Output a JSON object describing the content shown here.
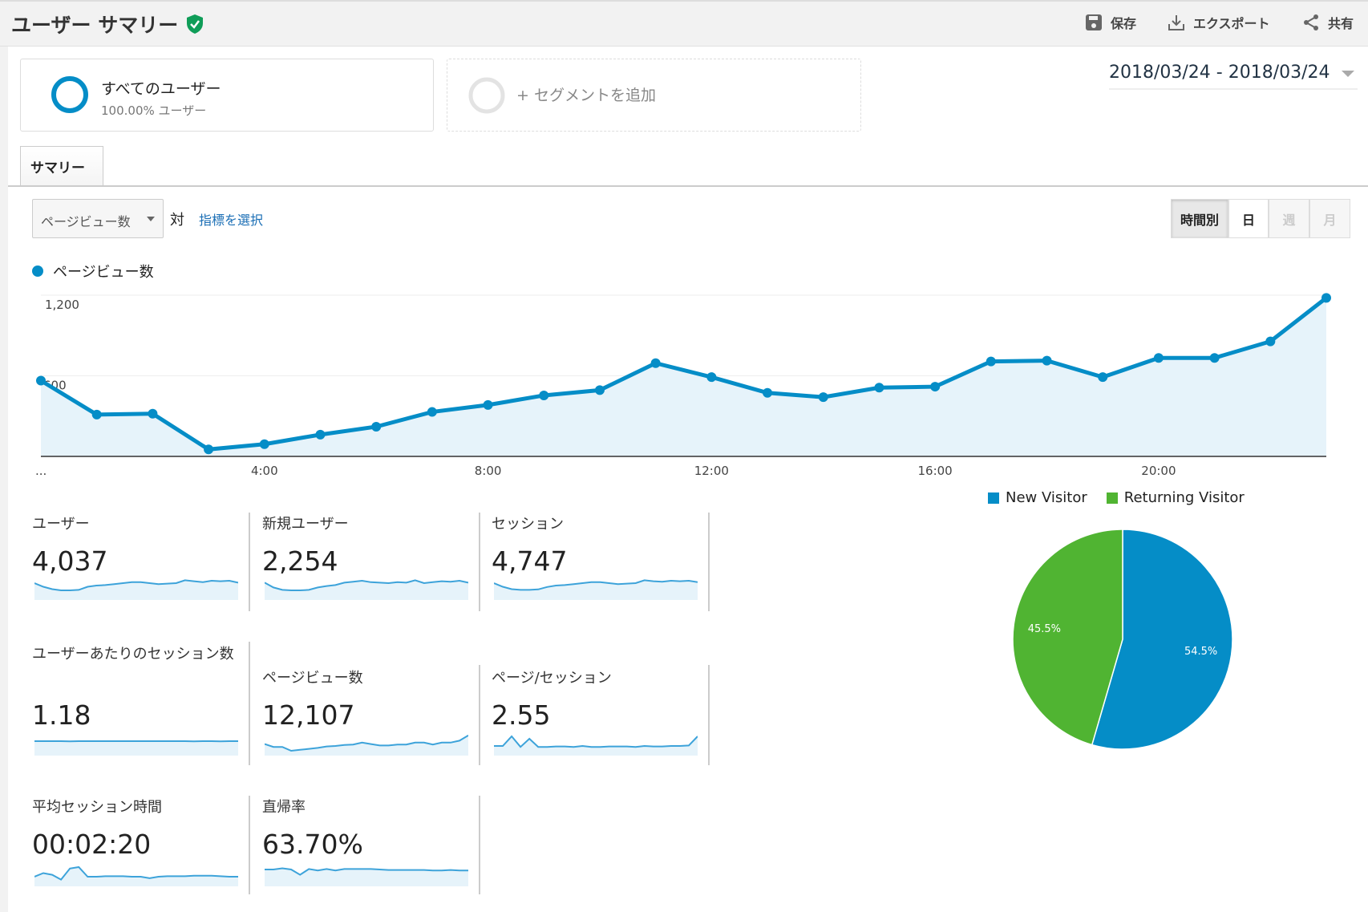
{
  "header": {
    "title": "ユーザー サマリー",
    "save": "保存",
    "export": "エクスポート",
    "share": "共有",
    "verified_icon": "shield-check-icon",
    "accent": "#0f9d58"
  },
  "segments": {
    "all_users": "すべてのユーザー",
    "all_users_sub": "100.00% ユーザー",
    "add_segment": "+ セグメントを追加"
  },
  "date_range": "2018/03/24 - 2018/03/24",
  "tabs": [
    {
      "label": "サマリー",
      "active": true
    }
  ],
  "metric_select": {
    "value": "ページビュー数",
    "vs": "対",
    "choose": "指標を選択"
  },
  "granularity": [
    {
      "label": "時間別",
      "active": true
    },
    {
      "label": "日",
      "active": false
    },
    {
      "label": "週",
      "disabled": true
    },
    {
      "label": "月",
      "disabled": true
    }
  ],
  "chart_data": [
    {
      "type": "area",
      "legend": "ページビュー数",
      "color": "#058dc7",
      "ylim": [
        0,
        1200
      ],
      "yticks": [
        "1,200",
        "600"
      ],
      "ytick_values": [
        1200,
        600
      ],
      "xticks": [
        "...",
        "4:00",
        "8:00",
        "12:00",
        "16:00",
        "20:00"
      ],
      "xtick_hours": [
        0,
        4,
        8,
        12,
        16,
        20
      ],
      "x": [
        0,
        1,
        2,
        3,
        4,
        5,
        6,
        7,
        8,
        9,
        10,
        11,
        12,
        13,
        14,
        15,
        16,
        17,
        18,
        19,
        20,
        21,
        22,
        23
      ],
      "values": [
        564,
        311,
        318,
        52,
        91,
        162,
        221,
        331,
        383,
        454,
        493,
        694,
        590,
        473,
        441,
        512,
        519,
        707,
        713,
        590,
        733,
        733,
        856,
        1180
      ],
      "grid": true
    },
    {
      "type": "pie",
      "legend_position": "top",
      "series": [
        {
          "name": "New Visitor",
          "value": 54.5,
          "label": "54.5%",
          "color": "#058dc7"
        },
        {
          "name": "Returning Visitor",
          "value": 45.5,
          "label": "45.5%",
          "color": "#50b432"
        }
      ]
    }
  ],
  "metrics": [
    {
      "label": "ユーザー",
      "value": "4,037",
      "spark": [
        70,
        55,
        45,
        40,
        40,
        42,
        55,
        60,
        62,
        66,
        70,
        74,
        74,
        70,
        66,
        68,
        70,
        82,
        78,
        74,
        80,
        78,
        80,
        72
      ]
    },
    {
      "label": "新規ユーザー",
      "value": "2,254",
      "spark": [
        72,
        52,
        42,
        40,
        40,
        42,
        52,
        58,
        62,
        72,
        76,
        80,
        74,
        72,
        70,
        74,
        72,
        82,
        70,
        74,
        78,
        76,
        80,
        72
      ]
    },
    {
      "label": "セッション",
      "value": "4,747",
      "spark": [
        70,
        55,
        45,
        42,
        42,
        44,
        54,
        60,
        62,
        66,
        70,
        74,
        74,
        70,
        66,
        68,
        70,
        82,
        78,
        76,
        80,
        78,
        80,
        74
      ]
    },
    {
      "label": "ユーザーあたりのセッション数",
      "value": "1.18",
      "spark": [
        60,
        60,
        60,
        60,
        59,
        60,
        60,
        60,
        60,
        60,
        60,
        60,
        60,
        60,
        60,
        60,
        60,
        60,
        59,
        60,
        60,
        59,
        60,
        60
      ]
    },
    {
      "label": "ページビュー数",
      "value": "12,107",
      "spark": [
        48,
        36,
        36,
        20,
        24,
        28,
        32,
        38,
        40,
        44,
        46,
        54,
        48,
        42,
        42,
        46,
        46,
        54,
        54,
        46,
        54,
        54,
        62,
        84
      ]
    },
    {
      "label": "ページ/セッション",
      "value": "2.55",
      "spark": [
        40,
        40,
        80,
        36,
        70,
        36,
        36,
        38,
        38,
        36,
        40,
        36,
        36,
        38,
        38,
        38,
        36,
        40,
        38,
        38,
        40,
        40,
        42,
        80
      ]
    },
    {
      "label": "平均セッション時間",
      "value": "00:02:20",
      "spark": [
        40,
        55,
        48,
        28,
        74,
        80,
        40,
        40,
        42,
        42,
        42,
        40,
        40,
        34,
        40,
        42,
        42,
        42,
        44,
        44,
        44,
        42,
        40,
        40
      ]
    },
    {
      "label": "直帰率",
      "value": "63.70%",
      "spark": [
        70,
        70,
        75,
        70,
        48,
        72,
        66,
        72,
        66,
        72,
        72,
        72,
        72,
        70,
        68,
        68,
        68,
        68,
        68,
        66,
        66,
        68,
        66,
        66
      ]
    }
  ]
}
